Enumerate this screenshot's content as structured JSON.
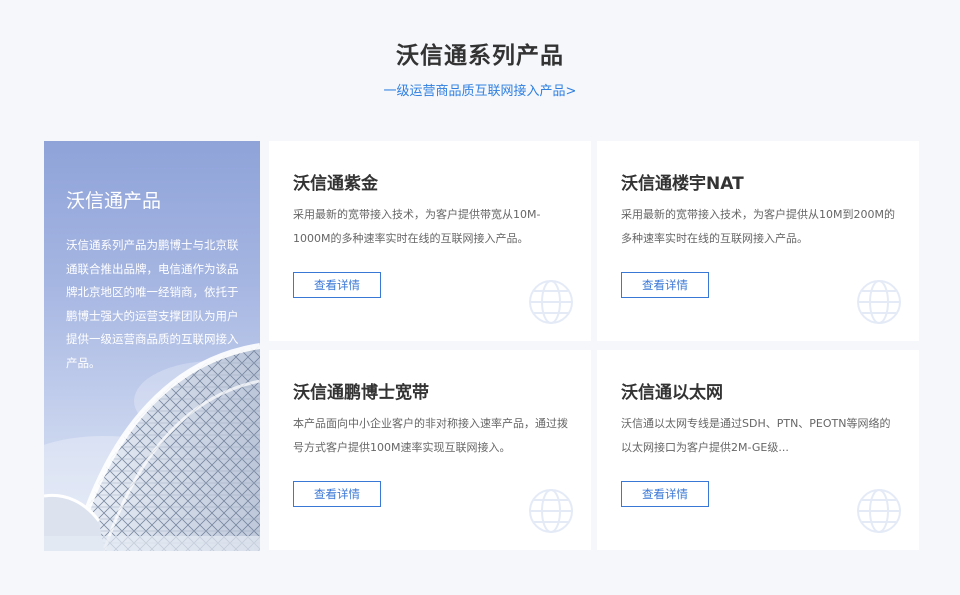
{
  "section": {
    "title": "沃信通系列产品",
    "link": "一级运营商品质互联网接入产品>"
  },
  "intro": {
    "title": "沃信通产品",
    "description": "沃信通系列产品为鹏博士与北京联通联合推出品牌，电信通作为该品牌北京地区的唯一经销商，依托于鹏博士强大的运营支撑团队为用户提供一级运营商品质的互联网接入产品。"
  },
  "products": [
    {
      "title": "沃信通紫金",
      "description": "采用最新的宽带接入技术，为客户提供带宽从10M-1000M的多种速率实时在线的互联网接入产品。",
      "button": "查看详情"
    },
    {
      "title": "沃信通楼宇NAT",
      "description": "采用最新的宽带接入技术，为客户提供从10M到200M的多种速率实时在线的互联网接入产品。",
      "button": "查看详情"
    },
    {
      "title": "沃信通鹏博士宽带",
      "description": "本产品面向中小企业客户的非对称接入速率产品，通过拨号方式客户提供100M速率实现互联网接入。",
      "button": "查看详情"
    },
    {
      "title": "沃信通以太网",
      "description": "沃信通以太网专线是通过SDH、PTN、PEOTN等网络的以太网接口为客户提供2M-GE级...",
      "button": "查看详情"
    }
  ],
  "icons": {
    "card_watermark": "globe-icon"
  },
  "colors": {
    "accent": "#3a78d6",
    "link": "#2f7fe0",
    "panel": "#9fb0df",
    "background": "#f5f7fb"
  }
}
